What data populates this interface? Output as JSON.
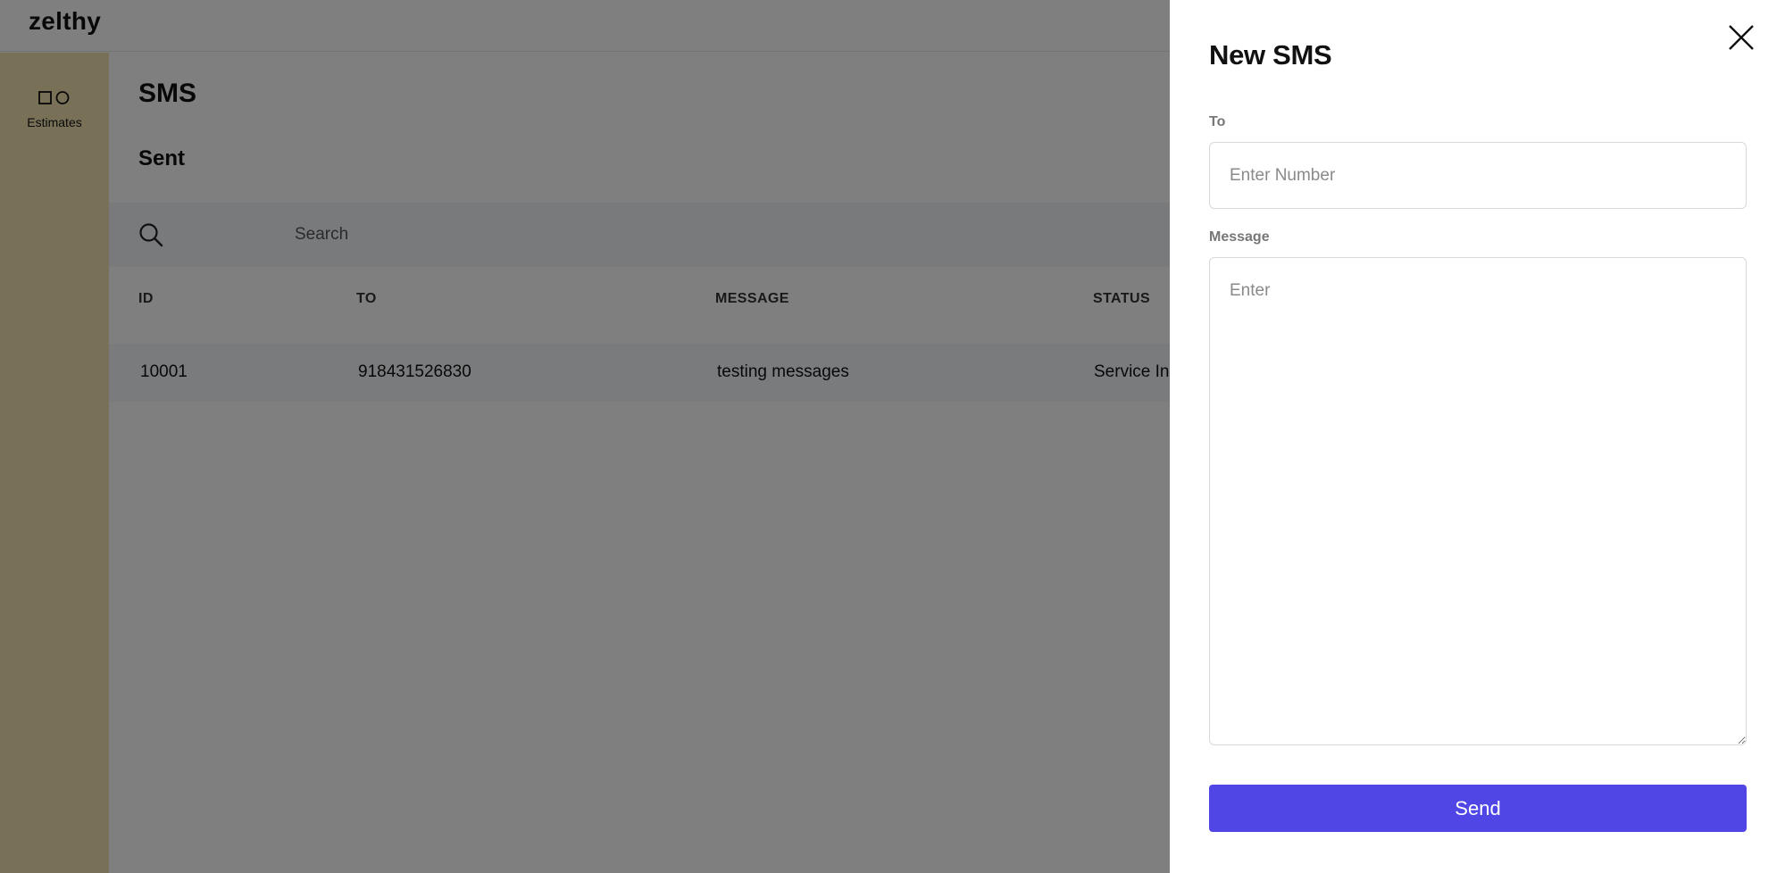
{
  "app": {
    "brand": "zelthy"
  },
  "sidebar": {
    "items": [
      {
        "label": "Estimates",
        "icon": "shapes-icon"
      }
    ]
  },
  "main": {
    "page_title": "SMS",
    "section_title": "Sent",
    "search": {
      "placeholder": "Search",
      "value": ""
    },
    "table": {
      "columns": [
        "ID",
        "TO",
        "MESSAGE",
        "STATUS"
      ],
      "rows": [
        [
          "10001",
          "918431526830",
          "testing messages",
          "Service In"
        ]
      ]
    }
  },
  "drawer": {
    "title": "New SMS",
    "to_label": "To",
    "to_placeholder": "Enter Number",
    "to_value": "",
    "message_label": "Message",
    "message_placeholder": "Enter",
    "message_value": "",
    "send_label": "Send"
  },
  "colors": {
    "accent": "#4f46e5",
    "sidebar": "#f0e3b0",
    "overlay": "rgba(0,0,0,0.5)"
  }
}
